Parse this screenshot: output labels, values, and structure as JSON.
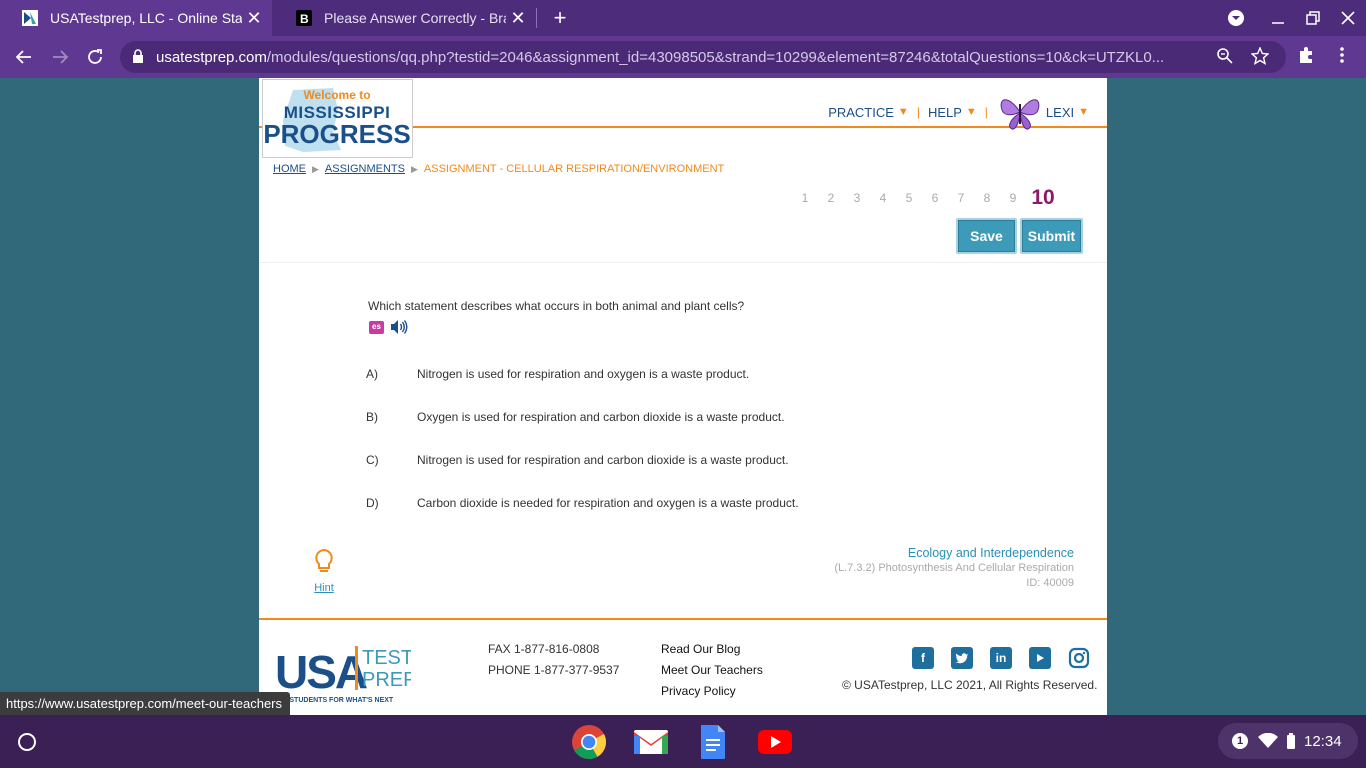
{
  "browser": {
    "tabs": [
      {
        "title": "USATestprep, LLC - Online State-",
        "active": true
      },
      {
        "title": "Please Answer Correctly - Brainly",
        "active": false
      }
    ],
    "url_host": "usatestprep.com",
    "url_rest": "/modules/questions/qq.php?testid=2046&assignment_id=43098505&strand=10299&element=87246&totalQuestions=10&ck=UTZKL0...",
    "status_url": "https://www.usatestprep.com/meet-our-teachers"
  },
  "header": {
    "logo_line1": "Welcome to",
    "logo_line2": "MISSISSIPPI",
    "logo_line3": "PROGRESS",
    "nav": {
      "practice": "PRACTICE",
      "help": "HELP",
      "user": "LEXI"
    }
  },
  "breadcrumb": {
    "home": "HOME",
    "assignments": "ASSIGNMENTS",
    "current": "ASSIGNMENT - CELLULAR RESPIRATION/ENVIRONMENT"
  },
  "question_nav": {
    "numbers": [
      "1",
      "2",
      "3",
      "4",
      "5",
      "6",
      "7",
      "8",
      "9"
    ],
    "current": "10"
  },
  "actions": {
    "save": "Save",
    "submit": "Submit"
  },
  "question": {
    "text": "Which statement describes what occurs in both animal and plant cells?",
    "es_label": "es",
    "choices": [
      {
        "letter": "A)",
        "text": "Nitrogen is used for respiration and oxygen is a waste product."
      },
      {
        "letter": "B)",
        "text": "Oxygen is used for respiration and carbon dioxide is a waste product."
      },
      {
        "letter": "C)",
        "text": "Nitrogen is used for respiration and carbon dioxide is a waste product."
      },
      {
        "letter": "D)",
        "text": "Carbon dioxide is needed for respiration and oxygen is a waste product."
      }
    ]
  },
  "hint_label": "Hint",
  "meta": {
    "domain": "Ecology and Interdependence",
    "standard": "(L.7.3.2) Photosynthesis And Cellular Respiration",
    "id": "ID: 40009"
  },
  "footer": {
    "logo_usa": "USA",
    "logo_test": "TEST",
    "logo_prep": "PREP",
    "logo_tagline": "ING STUDENTS FOR WHAT'S NEXT",
    "fax": "FAX 1-877-816-0808",
    "phone": "PHONE 1-877-377-9537",
    "links": [
      "Read Our Blog",
      "Meet Our Teachers",
      "Privacy Policy"
    ],
    "copyright": "© USATestprep, LLC 2021, All Rights Reserved.",
    "social_icons": [
      "facebook-icon",
      "twitter-icon",
      "linkedin-icon",
      "youtube-icon",
      "instagram-icon"
    ]
  },
  "shelf": {
    "notification_count": "1",
    "time": "12:34",
    "apps": [
      "chrome-icon",
      "gmail-icon",
      "docs-icon",
      "youtube-icon"
    ]
  },
  "colors": {
    "brand_orange": "#f08a1c",
    "brand_blue": "#1b4f8a",
    "button_teal": "#3d9ab8",
    "current_question": "#8b1a68",
    "page_bg": "#31687a",
    "browser_purple": "#5f3891"
  }
}
